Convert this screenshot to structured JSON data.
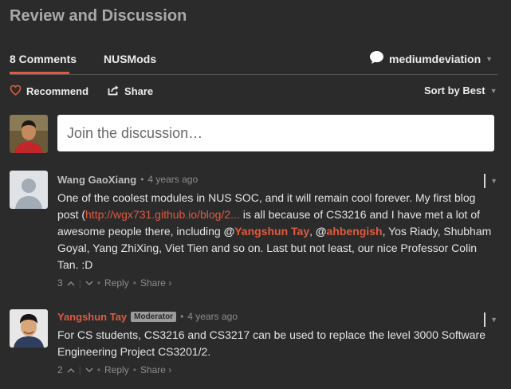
{
  "header": {
    "title": "Review and Discussion"
  },
  "tabs": {
    "comments_label": "8 Comments",
    "forum_label": "NUSMods",
    "username": "mediumdeviation"
  },
  "actions": {
    "recommend_label": "Recommend",
    "share_label": "Share",
    "sort_label": "Sort by Best"
  },
  "composer": {
    "placeholder": "Join the discussion…"
  },
  "colors": {
    "accent": "#e05a3f",
    "background": "#2b2b2b"
  },
  "comments": [
    {
      "author": "Wang GaoXiang",
      "time": "4 years ago",
      "text_1": "One of the coolest modules in NUS SOC, and it will remain cool forever. My first blog post (",
      "link": "http://wgx731.github.io/blog/2...",
      "text_2": " is all because of CS3216 and I have met a lot of awesome people there, including ",
      "mention_1": "Yangshun Tay",
      "text_3": ", ",
      "mention_2": "ahbengish",
      "text_4": ", Yos Riady, Shubham Goyal, Yang ZhiXing, Viet Tien and so on. Last but not least, our nice Professor Colin Tan. :D",
      "votes": "3",
      "reply": "Reply",
      "share": "Share ›"
    },
    {
      "author": "Yangshun Tay",
      "badge": "Moderator",
      "time": "4 years ago",
      "text": "For CS students, CS3216 and CS3217 can be used to replace the level 3000 Software Engineering Project CS3201/2.",
      "votes": "2",
      "reply": "Reply",
      "share": "Share ›"
    }
  ]
}
